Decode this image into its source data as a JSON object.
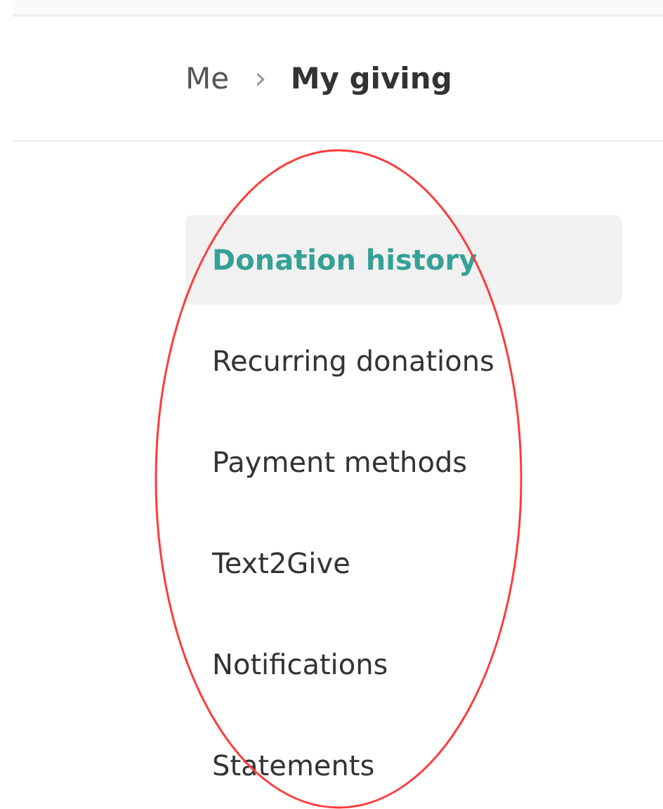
{
  "breadcrumb": {
    "parent": "Me",
    "separator": "›",
    "current": "My giving"
  },
  "menu": [
    {
      "label": "Donation history",
      "selected": true
    },
    {
      "label": "Recurring donations",
      "selected": false
    },
    {
      "label": "Payment methods",
      "selected": false
    },
    {
      "label": "Text2Give",
      "selected": false
    },
    {
      "label": "Notifications",
      "selected": false
    },
    {
      "label": "Statements",
      "selected": false
    }
  ],
  "annotation": {
    "kind": "ellipse",
    "color": "#ff3b3b"
  }
}
